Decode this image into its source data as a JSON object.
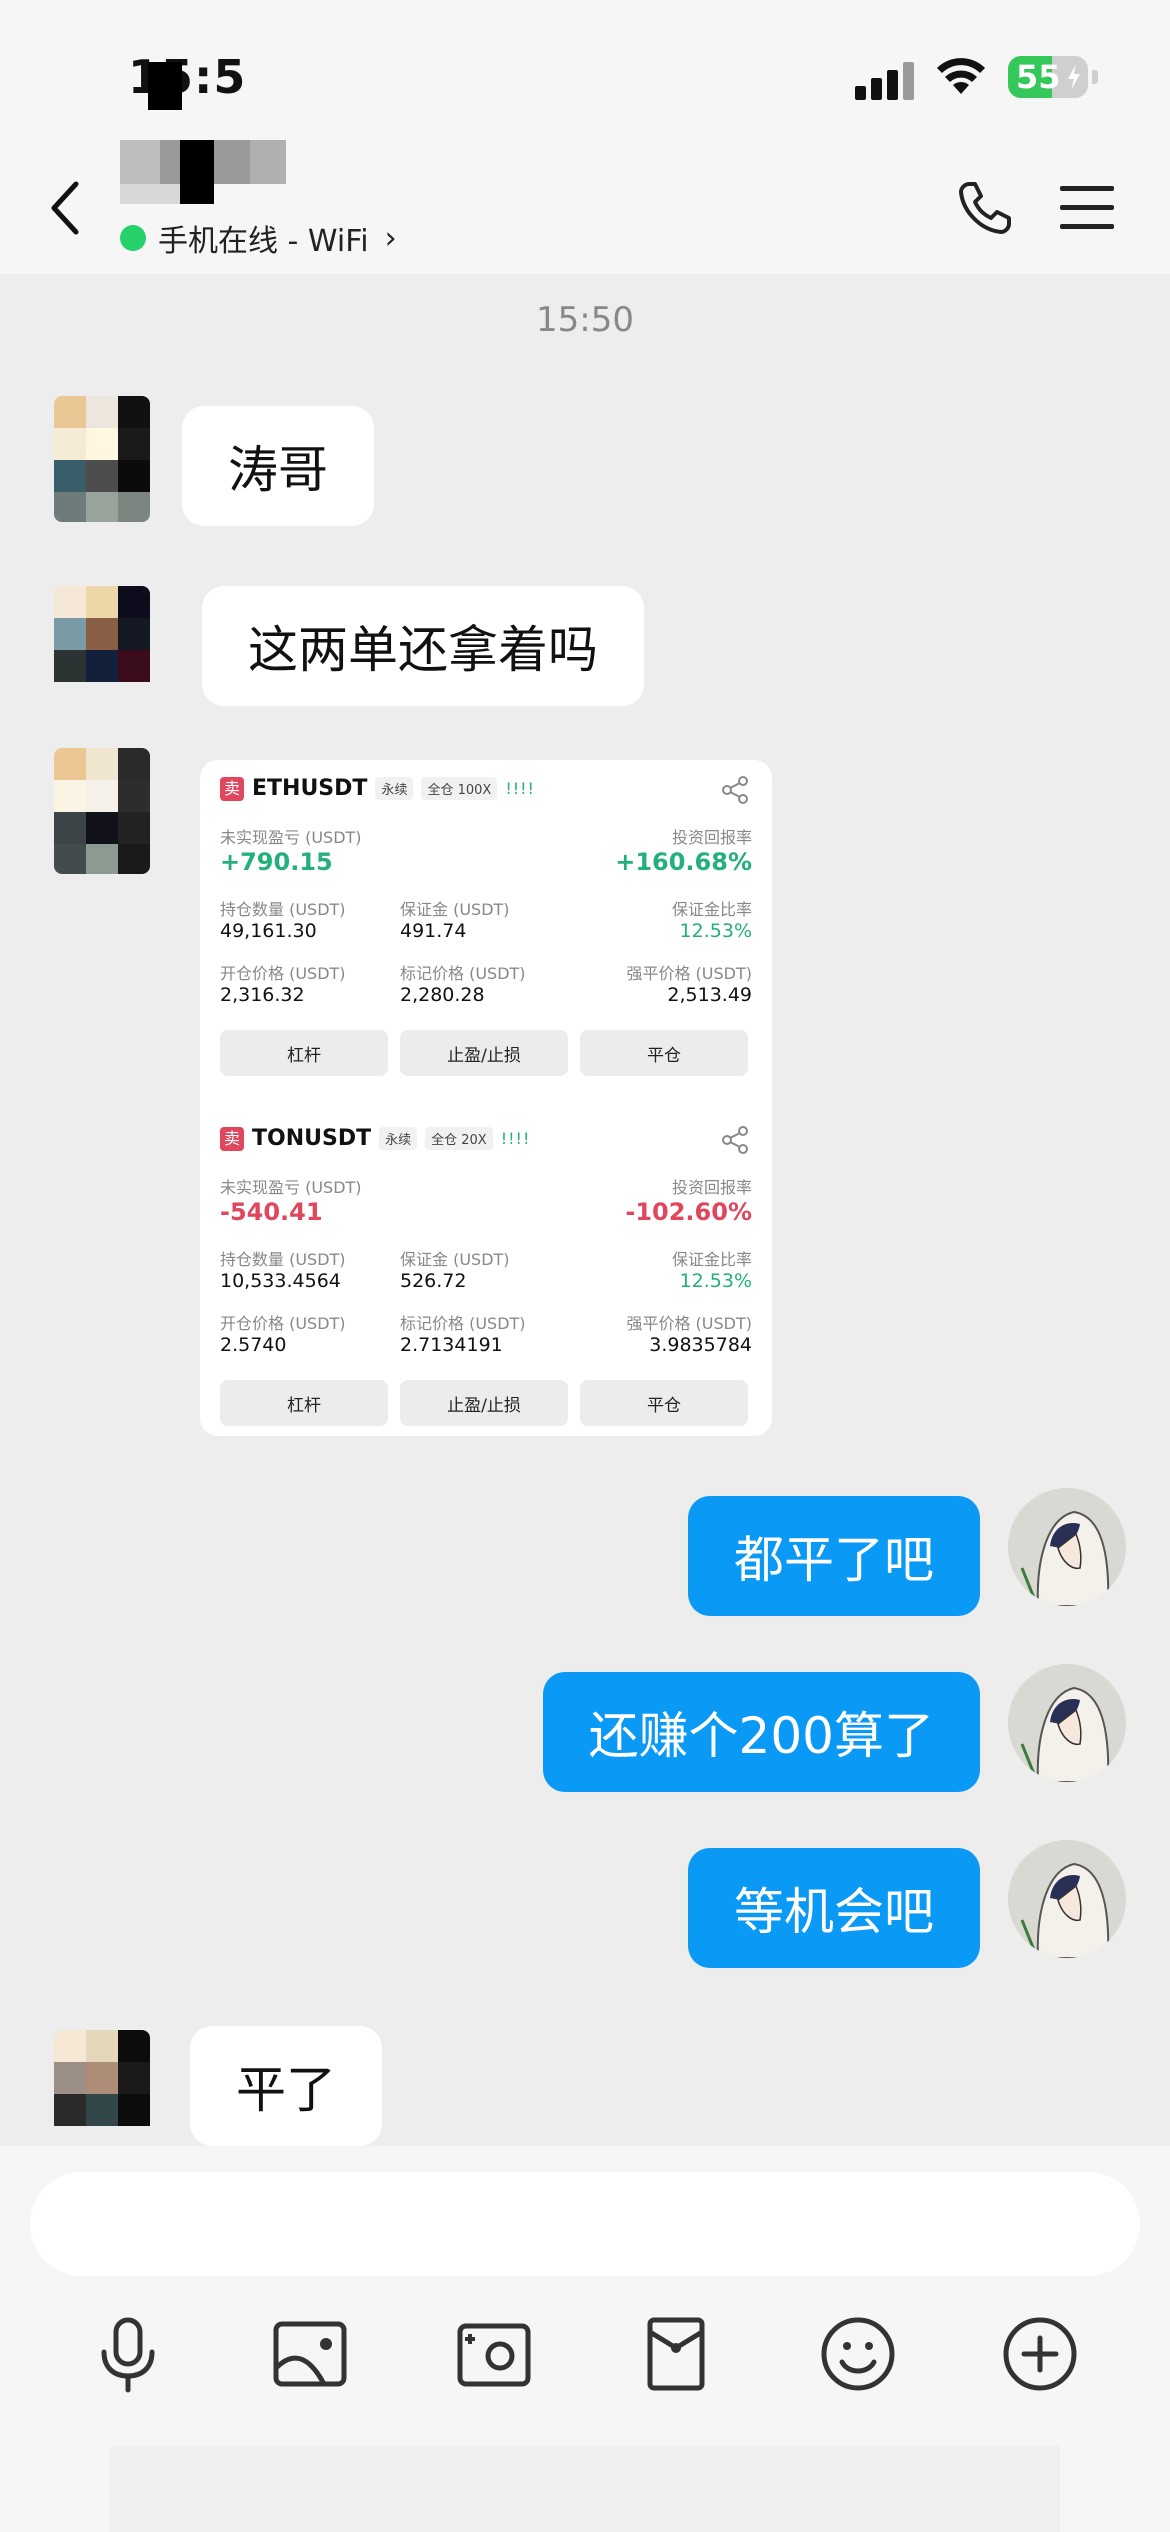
{
  "status_bar": {
    "time": "15:5",
    "battery": "55",
    "battery_level": 0.55
  },
  "header": {
    "contact_name": "",
    "presence": "手机在线 - WiFi",
    "presence_chevron": "›"
  },
  "chat": {
    "timestamp": "15:50",
    "incoming_1": "涛哥",
    "incoming_2": "这两单还拿着吗",
    "outgoing_1": "都平了吧",
    "outgoing_2": "还赚个200算了",
    "outgoing_3": "等机会吧",
    "incoming_3": "平了"
  },
  "card": {
    "positions": [
      {
        "pair": "ETHUSDT",
        "sell_tag": "卖",
        "contract": "永续",
        "margin": "全仓 100X",
        "bars": "!!!!",
        "pnl_label": "未实现盈亏 (USDT)",
        "pnl": "+790.15",
        "roi_label": "投资回报率",
        "roi": "+160.68%",
        "size_label": "持仓数量 (USDT)",
        "size": "49,161.30",
        "margin_label": "保证金 (USDT)",
        "margin_value": "491.74",
        "margin_ratio_label": "保证金比率",
        "margin_ratio": "12.53%",
        "entry_label": "开仓价格 (USDT)",
        "entry": "2,316.32",
        "mark_label": "标记价格 (USDT)",
        "mark": "2,280.28",
        "liq_label": "强平价格 (USDT)",
        "liq": "2,513.49",
        "btn_leverage": "杠杆",
        "btn_tpsl": "止盈/止损",
        "btn_close": "平仓"
      },
      {
        "pair": "TONUSDT",
        "sell_tag": "卖",
        "contract": "永续",
        "margin": "全仓 20X",
        "bars": "!!!!",
        "pnl_label": "未实现盈亏 (USDT)",
        "pnl": "-540.41",
        "roi_label": "投资回报率",
        "roi": "-102.60%",
        "size_label": "持仓数量 (USDT)",
        "size": "10,533.4564",
        "margin_label": "保证金 (USDT)",
        "margin_value": "526.72",
        "margin_ratio_label": "保证金比率",
        "margin_ratio": "12.53%",
        "entry_label": "开仓价格 (USDT)",
        "entry": "2.5740",
        "mark_label": "标记价格 (USDT)",
        "mark": "2.7134191",
        "liq_label": "强平价格 (USDT)",
        "liq": "3.9835784",
        "btn_leverage": "杠杆",
        "btn_tpsl": "止盈/止损",
        "btn_close": "平仓"
      }
    ]
  },
  "input": {
    "placeholder": ""
  },
  "toolbar": [
    "microphone-icon",
    "image-icon",
    "camera-icon",
    "red-packet-icon",
    "emoji-icon",
    "plus-icon"
  ],
  "colors": {
    "outgoing_bubble": "#0a99f5",
    "profit": "#23b07a",
    "loss": "#e0465c",
    "online": "#27d16a"
  }
}
